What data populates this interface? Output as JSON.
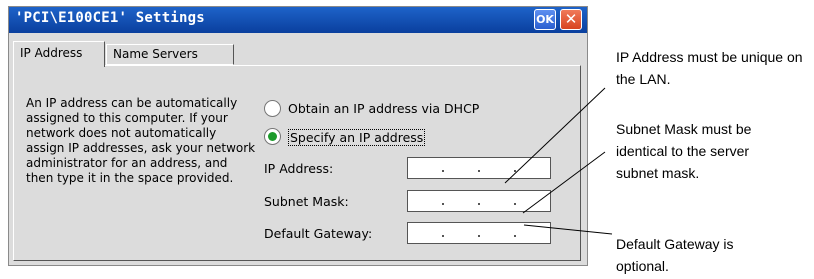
{
  "dialog": {
    "title": "'PCI\\E100CE1' Settings",
    "ok_label": "OK",
    "close_label": "✕"
  },
  "tabs": [
    {
      "label": "IP Address",
      "active": true
    },
    {
      "label": "Name Servers",
      "active": false
    }
  ],
  "description": "An IP address can be automatically assigned to this computer.  If your network does not automatically assign IP addresses, ask your network administrator for an address, and then type it in the space provided.",
  "options": {
    "dhcp": {
      "label": "Obtain an IP address via DHCP",
      "selected": false
    },
    "specify": {
      "label": "Specify an IP address",
      "selected": true
    }
  },
  "fields": {
    "ip_address": {
      "label": "IP Address:",
      "value": ". . ."
    },
    "subnet_mask": {
      "label": "Subnet Mask:",
      "value": ". . ."
    },
    "default_gateway": {
      "label": "Default Gateway:",
      "value": ". . ."
    }
  },
  "callouts": {
    "ip": "IP Address must be unique on the LAN.",
    "subnet": "Subnet Mask must be identical to the server subnet mask.",
    "gateway": "Default Gateway is optional."
  },
  "colors": {
    "titlebar": "#0a3f9e",
    "close": "#d8431f",
    "ok": "#2a5fd0",
    "radio_selected": "#1d9b2b"
  }
}
